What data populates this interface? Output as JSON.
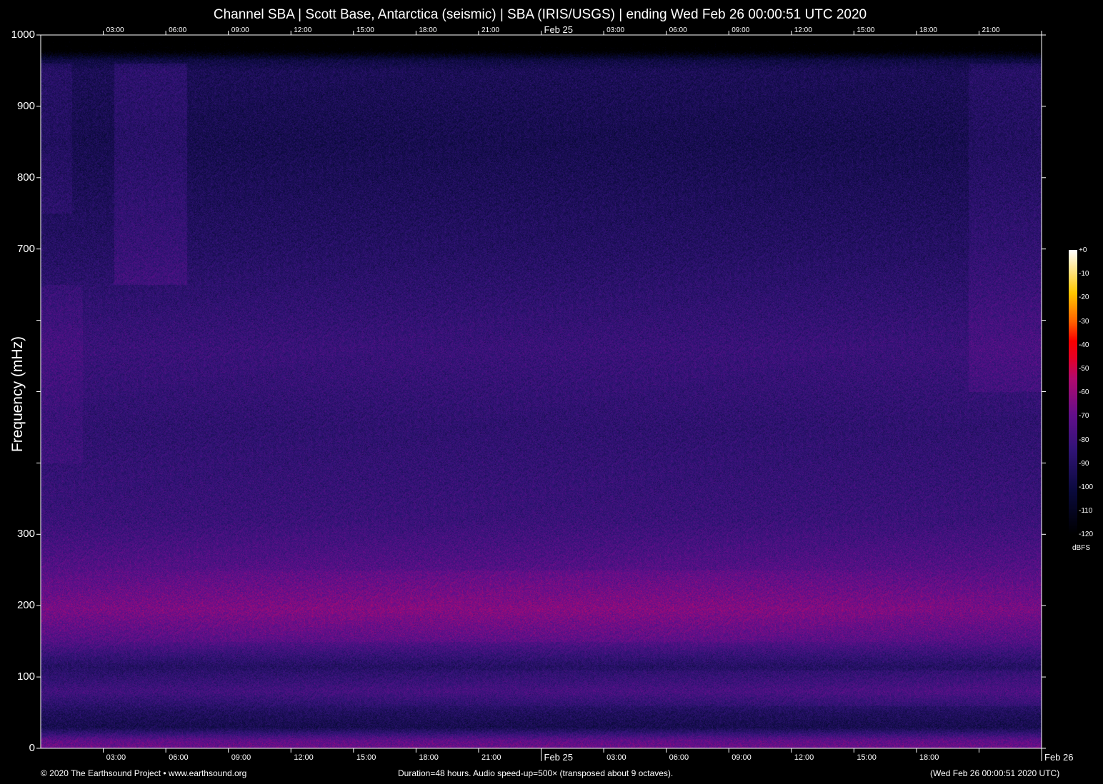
{
  "chart_data": {
    "type": "heatmap",
    "title": "Channel SBA | Scott Base, Antarctica (seismic) | SBA (IRIS/USGS) | ending Wed Feb 26 00:00:51 UTC 2020",
    "ylabel": "Frequency (mHz)",
    "ylim": [
      0,
      1000
    ],
    "y_ticks": [
      0,
      100,
      200,
      300,
      400,
      500,
      600,
      700,
      800,
      900,
      1000
    ],
    "y_tick_labels": [
      "0",
      "100",
      "200",
      "300",
      "",
      "",
      "",
      "700",
      "800",
      "900",
      "1000"
    ],
    "x_range_hours": [
      0,
      48
    ],
    "x_top_labels": [
      "03:00",
      "06:00",
      "09:00",
      "12:00",
      "15:00",
      "18:00",
      "21:00",
      "Feb 25",
      "03:00",
      "06:00",
      "09:00",
      "12:00",
      "15:00",
      "18:00",
      "21:00"
    ],
    "x_bottom_labels": [
      "03:00",
      "06:00",
      "09:00",
      "12:00",
      "15:00",
      "18:00",
      "21:00",
      "Feb 25",
      "03:00",
      "06:00",
      "09:00",
      "12:00",
      "15:00",
      "18:00",
      "",
      "Feb 26"
    ],
    "colorbar": {
      "label": "dBFS",
      "range": [
        -120,
        0
      ],
      "ticks": [
        "+0",
        "-10",
        "-20",
        "-30",
        "-40",
        "-50",
        "-60",
        "-70",
        "-80",
        "-90",
        "-100",
        "-110",
        "-120"
      ]
    },
    "frequency_profile_dbfs": [
      {
        "f": 0,
        "db": -68
      },
      {
        "f": 12,
        "db": -72
      },
      {
        "f": 30,
        "db": -96
      },
      {
        "f": 50,
        "db": -92
      },
      {
        "f": 80,
        "db": -80
      },
      {
        "f": 115,
        "db": -90
      },
      {
        "f": 150,
        "db": -75
      },
      {
        "f": 195,
        "db": -66
      },
      {
        "f": 250,
        "db": -74
      },
      {
        "f": 320,
        "db": -82
      },
      {
        "f": 450,
        "db": -86
      },
      {
        "f": 560,
        "db": -82
      },
      {
        "f": 700,
        "db": -90
      },
      {
        "f": 850,
        "db": -96
      },
      {
        "f": 950,
        "db": -94
      },
      {
        "f": 965,
        "db": -100
      },
      {
        "f": 980,
        "db": -125
      },
      {
        "f": 1000,
        "db": -130
      }
    ],
    "events": [
      {
        "hours": [
          3.5,
          7
        ],
        "f": [
          650,
          960
        ],
        "db_boost": 12
      },
      {
        "hours": [
          0,
          1.5
        ],
        "f": [
          750,
          960
        ],
        "db_boost": 8
      },
      {
        "hours": [
          44.5,
          48
        ],
        "f": [
          500,
          960
        ],
        "db_boost": 8
      },
      {
        "hours": [
          0,
          2
        ],
        "f": [
          400,
          650
        ],
        "db_boost": 6
      }
    ]
  },
  "footer": {
    "copyright": "© 2020 The Earthsound Project • www.earthsound.org",
    "duration": "Duration=48 hours. Audio speed-up=500× (transposed about 9 octaves).",
    "timestamp": "(Wed Feb 26 00:00:51 2020 UTC)"
  }
}
